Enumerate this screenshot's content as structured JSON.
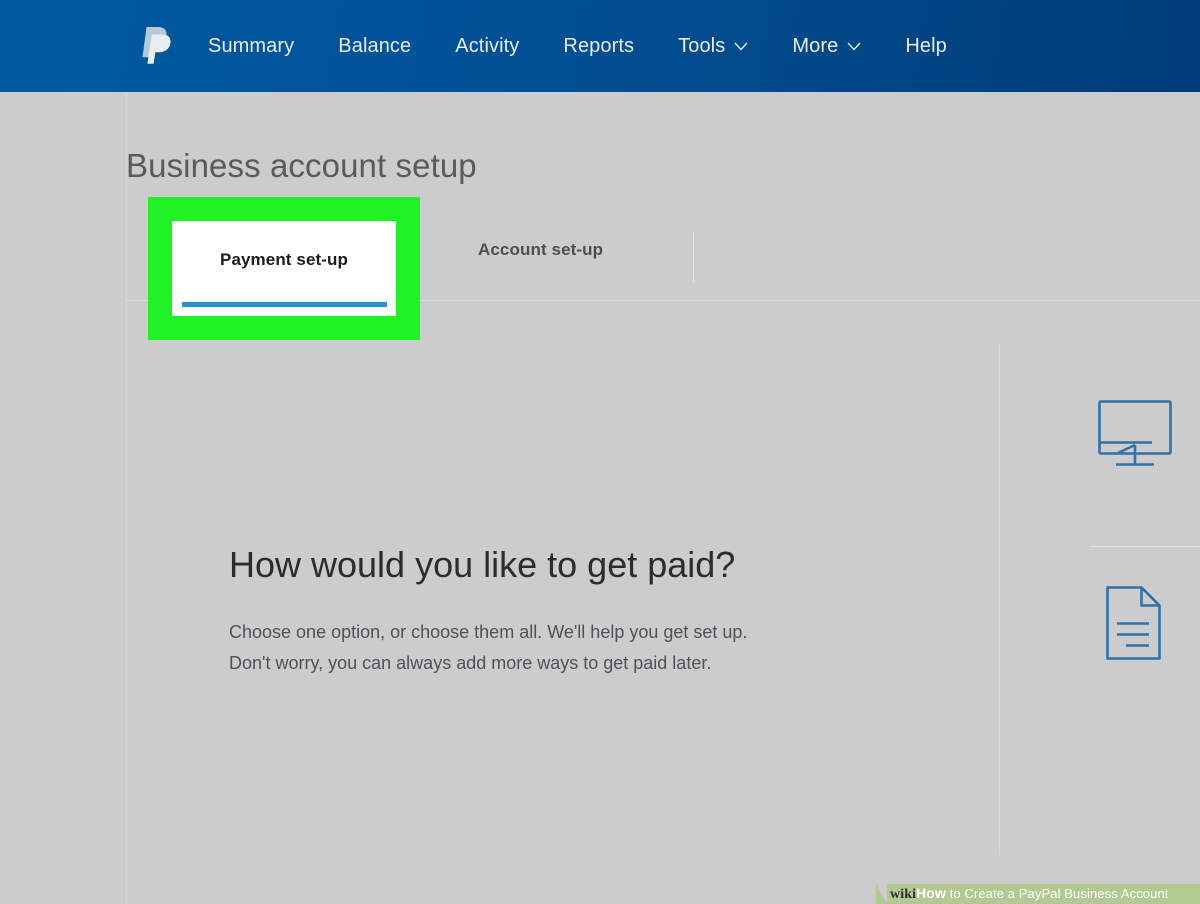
{
  "navbar": {
    "logo": "paypal-logo",
    "items": [
      {
        "label": "Summary",
        "has_caret": false
      },
      {
        "label": "Balance",
        "has_caret": false
      },
      {
        "label": "Activity",
        "has_caret": false
      },
      {
        "label": "Reports",
        "has_caret": false
      },
      {
        "label": "Tools",
        "has_caret": true
      },
      {
        "label": "More",
        "has_caret": true
      },
      {
        "label": "Help",
        "has_caret": false
      }
    ],
    "bg_color_left": "#00539b",
    "bg_color_right": "#003c77",
    "text_color": "#e9eef4"
  },
  "page": {
    "title": "Business account setup",
    "background_color": "#cccccc"
  },
  "tabs": [
    {
      "label": "Payment set-up",
      "active": true,
      "underline_color": "#2b8fd1"
    },
    {
      "label": "Account set-up",
      "active": false,
      "underline_color": ""
    }
  ],
  "annotation": {
    "highlight_color": "#1ef224",
    "card_background": "#ffffff",
    "target_label": "Payment set-up"
  },
  "main": {
    "heading": "How would you like to get paid?",
    "body_line1": "Choose one option, or choose them all. We'll help you get set up.",
    "body_line2": "Don't worry, you can always add more ways to get paid later."
  },
  "right_rail": {
    "icon_color": "#2d72a8",
    "items": [
      {
        "icon": "monitor-icon"
      },
      {
        "icon": "document-icon"
      }
    ]
  },
  "watermark": {
    "brand_wiki": "wiki",
    "brand_how": "How",
    "text": " to Create a PayPal Business Account",
    "background_color": "#b2ca92"
  }
}
